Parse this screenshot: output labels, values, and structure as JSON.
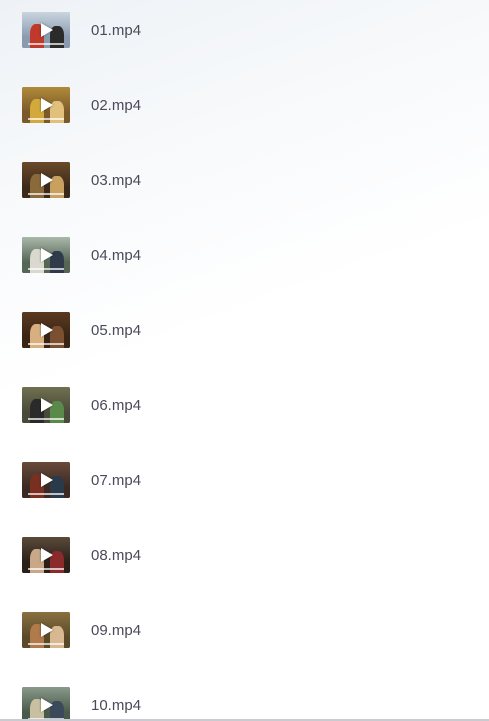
{
  "files": [
    {
      "name": "01.mp4",
      "thumb": {
        "bg": "#8a9bb0",
        "top": "#c9d4de",
        "a": "#c0392b",
        "b": "#2b2b2b"
      }
    },
    {
      "name": "02.mp4",
      "thumb": {
        "bg": "#7a5a2a",
        "top": "#b08a3a",
        "a": "#d4a93c",
        "b": "#e0c07a"
      }
    },
    {
      "name": "03.mp4",
      "thumb": {
        "bg": "#3b2a1a",
        "top": "#6b4a2a",
        "a": "#8a6a3a",
        "b": "#c8a060"
      }
    },
    {
      "name": "04.mp4",
      "thumb": {
        "bg": "#556655",
        "top": "#aab8aa",
        "a": "#d9d9cf",
        "b": "#2f3a4a"
      }
    },
    {
      "name": "05.mp4",
      "thumb": {
        "bg": "#3a2414",
        "top": "#5a3a20",
        "a": "#d8b080",
        "b": "#7a5030"
      }
    },
    {
      "name": "06.mp4",
      "thumb": {
        "bg": "#4a4a3a",
        "top": "#707050",
        "a": "#2a2a2a",
        "b": "#5a8a4a"
      }
    },
    {
      "name": "07.mp4",
      "thumb": {
        "bg": "#3a2a22",
        "top": "#6a4a3a",
        "a": "#7a3020",
        "b": "#2a3a4a"
      }
    },
    {
      "name": "08.mp4",
      "thumb": {
        "bg": "#2a2018",
        "top": "#5a4a3a",
        "a": "#c8a888",
        "b": "#8a2a2a"
      }
    },
    {
      "name": "09.mp4",
      "thumb": {
        "bg": "#5a4a2a",
        "top": "#8a7040",
        "a": "#b07a4a",
        "b": "#d8b890"
      }
    },
    {
      "name": "10.mp4",
      "thumb": {
        "bg": "#4a5a4a",
        "top": "#8a9a8a",
        "a": "#c8c0a0",
        "b": "#3a4a5a"
      }
    }
  ]
}
